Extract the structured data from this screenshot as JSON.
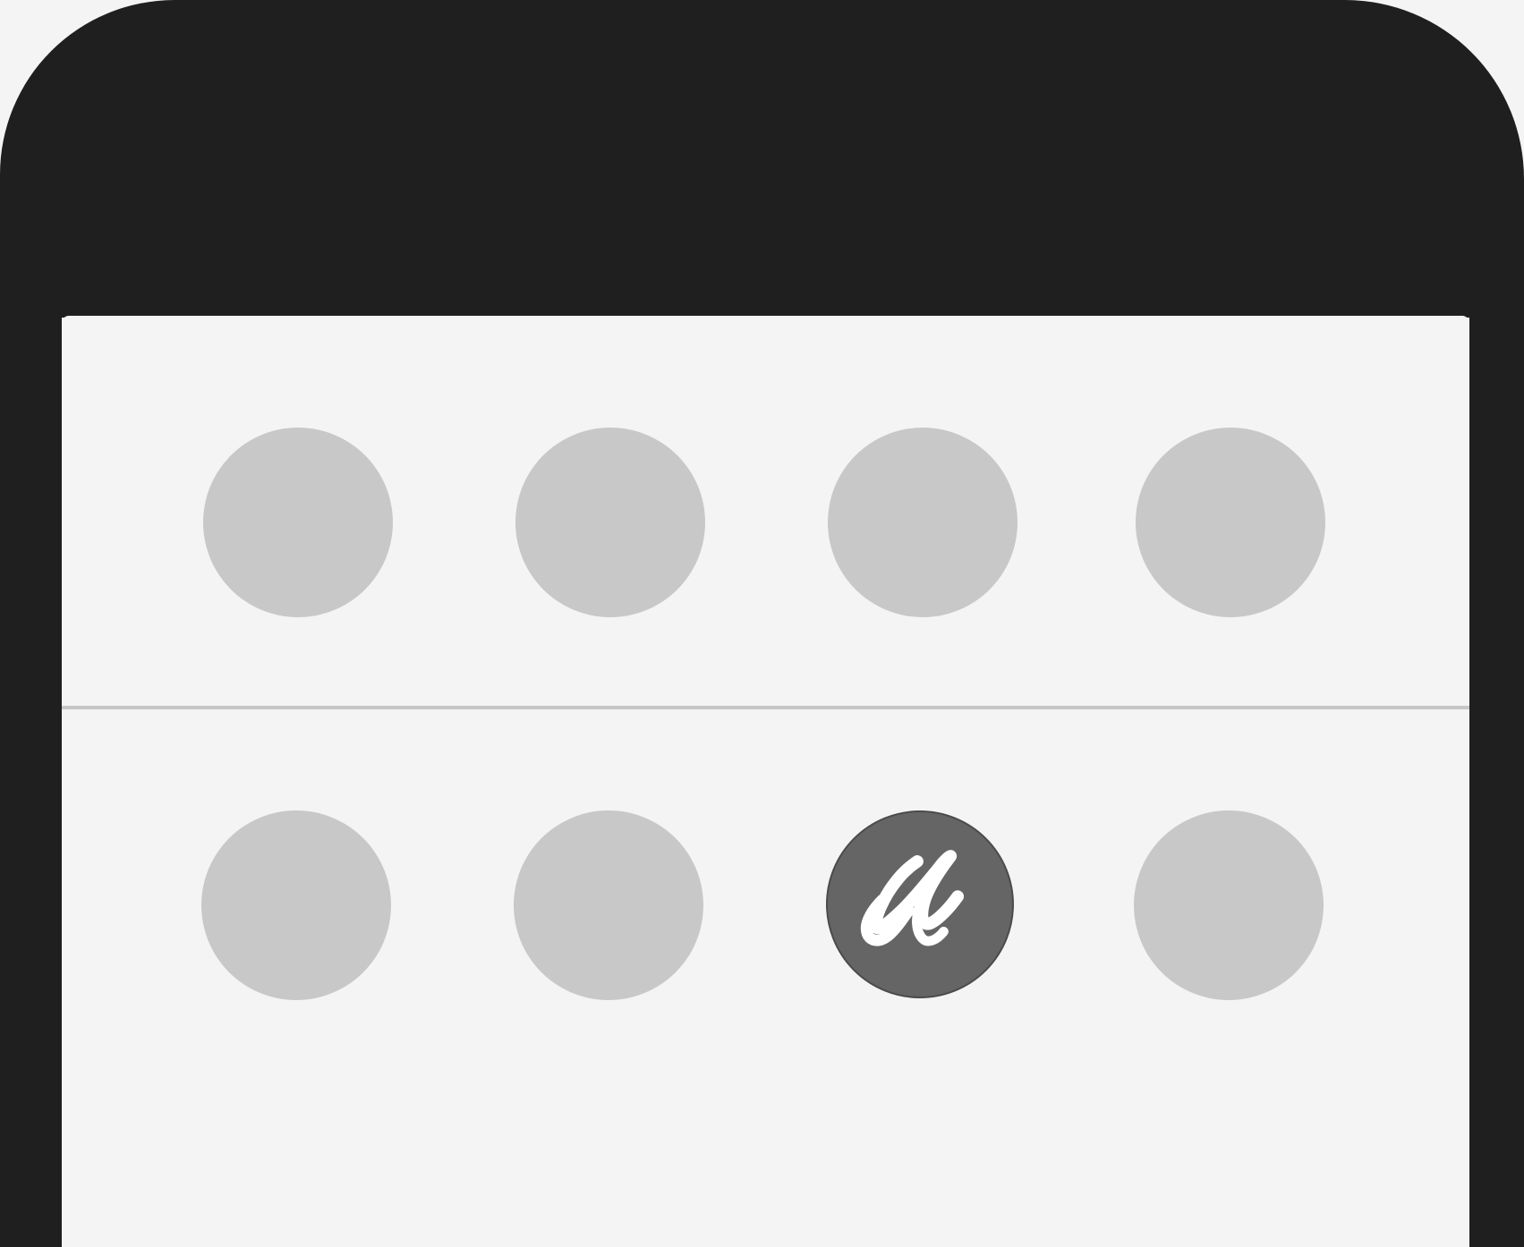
{
  "colors": {
    "bezel": "#1f1f1f",
    "screen": "#f4f4f4",
    "divider": "#c6c6c6",
    "slot_inactive": "#c8c8c8",
    "slot_active": "#656565",
    "logo": "#ffffff"
  },
  "grid": {
    "rows": [
      {
        "slots": [
          {
            "state": "empty"
          },
          {
            "state": "empty"
          },
          {
            "state": "empty"
          },
          {
            "state": "empty"
          }
        ]
      },
      {
        "slots": [
          {
            "state": "empty"
          },
          {
            "state": "empty"
          },
          {
            "state": "active",
            "icon": "script-u-logo-icon",
            "logo_text": "u"
          },
          {
            "state": "empty"
          }
        ]
      }
    ]
  }
}
